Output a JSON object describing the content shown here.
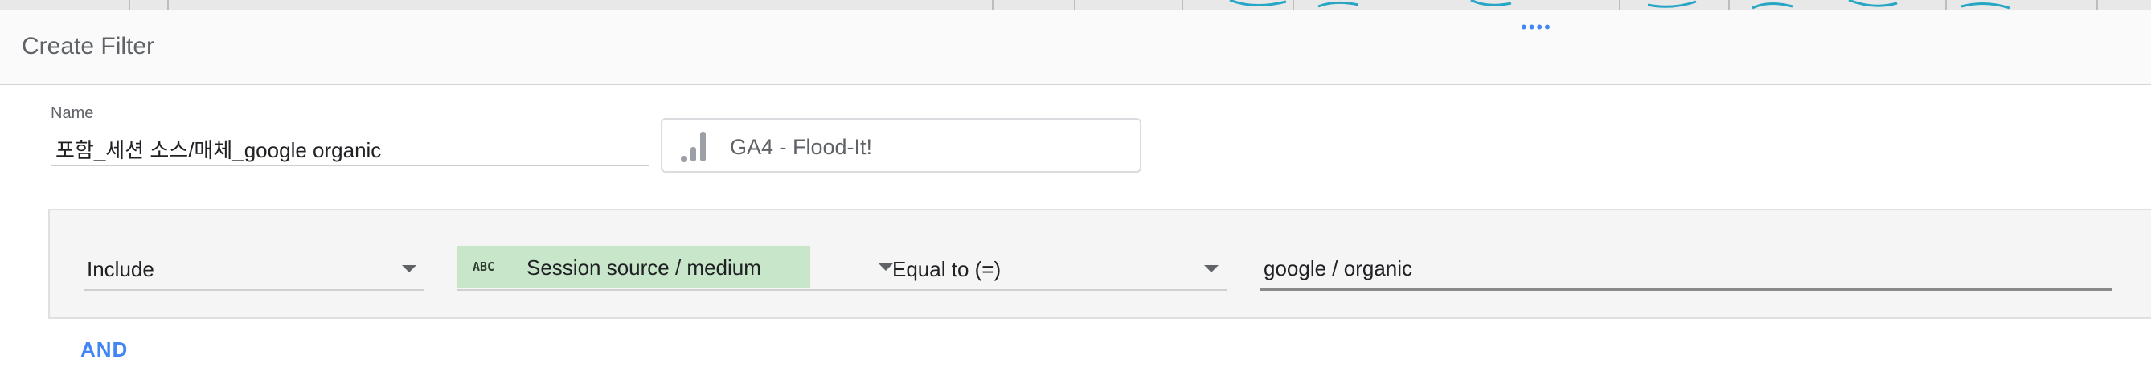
{
  "dialog": {
    "title": "Create Filter"
  },
  "filter_name": {
    "label": "Name",
    "value": "포함_세션 소스/매체_google organic"
  },
  "data_source": {
    "icon": "bar-chart-icon",
    "label": "GA4 - Flood-It!"
  },
  "clause": {
    "condition": "Include",
    "dimension": {
      "type_badge": "ABC",
      "label": "Session source / medium",
      "chip_color": "#c8e6c9"
    },
    "operator": "Equal to (=)",
    "value": "google / organic"
  },
  "and_button": {
    "label": "AND",
    "color": "#4285f4"
  }
}
